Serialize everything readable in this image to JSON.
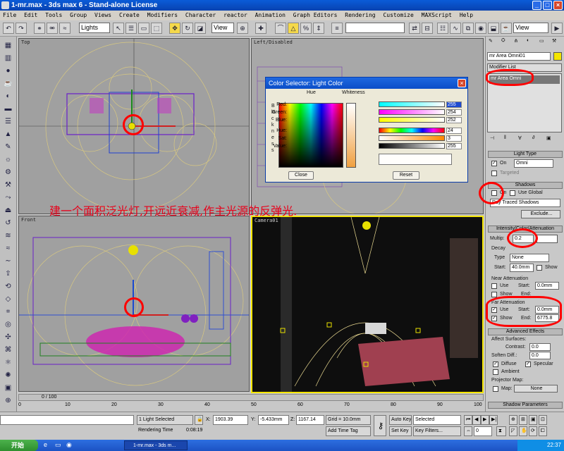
{
  "window": {
    "title": "1-mr.max - 3ds max 6 - Stand-alone License"
  },
  "menu": [
    "File",
    "Edit",
    "Tools",
    "Group",
    "Views",
    "Create",
    "Modifiers",
    "Character",
    "reactor",
    "Animation",
    "Graph Editors",
    "Rendering",
    "Customize",
    "MAXScript",
    "Help"
  ],
  "toolbar": {
    "selection_filter": "Lights",
    "ref_coord": "View",
    "ref_coord2": "View"
  },
  "viewports": {
    "top": "Top",
    "left": "Left/Disabled",
    "front": "Front",
    "camera": "Camera01"
  },
  "color_selector": {
    "title": "Color Selector: Light Color",
    "hue_label": "Hue",
    "whiteness_label": "Whiteness",
    "blackness_label": "Blackness",
    "red_label": "Red:",
    "red": "255",
    "green_label": "Green:",
    "green": "254",
    "blue_label": "Blue:",
    "blue": "252",
    "hue2_label": "Hue:",
    "hue": "24",
    "sat_label": "Sat:",
    "sat": "3",
    "value_label": "Value:",
    "value": "255",
    "close_btn": "Close",
    "reset_btn": "Reset"
  },
  "annotation": "建一个面积泛光灯,开远近衰减,作主光源的反弹光.",
  "right_panel": {
    "object_name": "mr Area Omni01",
    "modifier_list": "Modifier List",
    "stack_item": "mr Area Omni",
    "light_type_hdr": "Light Type",
    "on_label": "On",
    "light_type": "Omni",
    "targeted": "Targeted",
    "shadows_hdr": "Shadows",
    "shadow_on": "On",
    "use_global": "Use Global",
    "shadow_type": "Ray Traced Shadows",
    "exclude_btn": "Exclude...",
    "intensity_hdr": "Intensity/Color/Attenuation",
    "multiplier_label": "Multip:",
    "multiplier": "0.2",
    "decay_hdr": "Decay",
    "decay_type_label": "Type",
    "decay_type": "None",
    "decay_start_label": "Start:",
    "decay_start": "40.0mm",
    "show_label": "Show",
    "near_atten_hdr": "Near Attenuation",
    "use_label": "Use",
    "start_label": "Start:",
    "near_start": "0.0mm",
    "end_label": "End:",
    "far_atten_hdr": "Far Attenuation",
    "far_start": "0.0mm",
    "far_end": "6775.8",
    "adv_effects_hdr": "Advanced Effects",
    "affect_surfaces": "Affect Surfaces:",
    "contrast_label": "Contrast:",
    "contrast": "0.0",
    "soften_label": "Soften Diff.:",
    "soften": "0.0",
    "diffuse_label": "Diffuse",
    "specular_label": "Specular",
    "ambient_label": "Ambient",
    "projector_hdr": "Projector Map:",
    "map_label": "Map:",
    "map_value": "None",
    "shadow_params_hdr": "Shadow Parameters"
  },
  "timeline": {
    "frame": "0 / 100",
    "ticks": [
      "0",
      "10",
      "20",
      "30",
      "40",
      "50",
      "60",
      "70",
      "80",
      "90",
      "100"
    ]
  },
  "status": {
    "selection": "1 Light Selected",
    "render_time_label": "Rendering Time",
    "render_time": "0:08:19",
    "x_label": "X:",
    "x": "1903.39",
    "y_label": "Y:",
    "y": "-5.433mm",
    "z_label": "Z:",
    "z": "1167.14",
    "grid": "Grid = 10.0mm",
    "add_time_tag": "Add Time Tag",
    "auto_key": "Auto Key",
    "selected": "Selected",
    "set_key": "Set Key",
    "key_filters": "Key Filters...",
    "frame_value": "0"
  },
  "taskbar": {
    "start": "开始",
    "task": "1-mr.max - 3ds m...",
    "clock": "22:37"
  }
}
